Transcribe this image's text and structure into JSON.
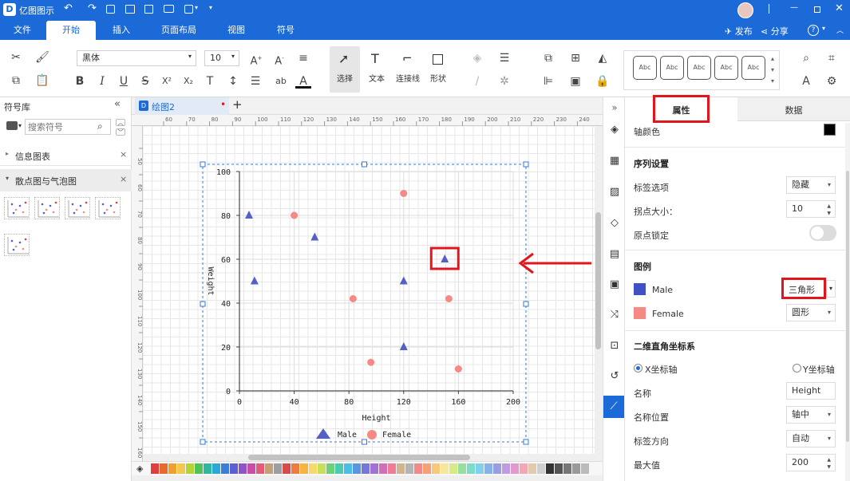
{
  "app": {
    "title": "亿图图示"
  },
  "menu": {
    "items": [
      "文件",
      "开始",
      "插入",
      "页面布局",
      "视图",
      "符号"
    ],
    "right": {
      "publish": "发布",
      "share": "分享",
      "help": "?"
    }
  },
  "ribbon": {
    "font_family": "黑体",
    "font_size": "10",
    "tools": {
      "select": "选择",
      "text": "文本",
      "connector": "连接线",
      "shape": "形状"
    },
    "style_box": "Abc"
  },
  "left_panel": {
    "title": "符号库",
    "search_placeholder": "搜索符号",
    "categories": [
      {
        "label": "信息图表",
        "expanded": false
      },
      {
        "label": "散点图与气泡图",
        "expanded": true
      }
    ]
  },
  "canvas": {
    "tab_label": "绘图2",
    "ruler_h": [
      "60",
      "70",
      "80",
      "90",
      "100",
      "110",
      "120",
      "130",
      "140",
      "150",
      "160",
      "170",
      "180",
      "190",
      "200",
      "210",
      "220",
      "230",
      "240"
    ],
    "ruler_v": [
      "50",
      "60",
      "70",
      "80",
      "90",
      "100",
      "110",
      "120",
      "130",
      "140",
      "150",
      "160"
    ]
  },
  "chart_data": {
    "type": "scatter",
    "xlabel": "Height",
    "ylabel": "Weight",
    "xlim": [
      0,
      200
    ],
    "ylim": [
      0,
      100
    ],
    "xticks": [
      "0",
      "40",
      "80",
      "120",
      "160",
      "200"
    ],
    "yticks": [
      "0",
      "20",
      "40",
      "60",
      "80",
      "100"
    ],
    "grid": true,
    "legend_position": "bottom",
    "series": [
      {
        "name": "Male",
        "marker": "triangle",
        "color": "#5560c4",
        "points": [
          [
            7,
            80
          ],
          [
            11,
            50
          ],
          [
            55,
            70
          ],
          [
            120,
            50
          ],
          [
            120,
            20
          ],
          [
            150,
            60
          ]
        ]
      },
      {
        "name": "Female",
        "marker": "circle",
        "color": "#f58a85",
        "points": [
          [
            40,
            80
          ],
          [
            83,
            42
          ],
          [
            96,
            13
          ],
          [
            120,
            90
          ],
          [
            153,
            42
          ],
          [
            160,
            10
          ]
        ]
      }
    ]
  },
  "right_panel": {
    "tabs": {
      "properties": "属性",
      "data": "数据"
    },
    "axis_color_label": "轴颜色",
    "series_settings": {
      "title": "序列设置",
      "label_option": "标签选项",
      "label_option_value": "隐藏",
      "point_size": "拐点大小：",
      "point_size_value": "10",
      "origin_lock": "原点锁定"
    },
    "legend": {
      "title": "图例",
      "items": [
        {
          "name": "Male",
          "color": "#3f51c4",
          "shape": "三角形"
        },
        {
          "name": "Female",
          "color": "#f58a85",
          "shape": "圆形"
        }
      ]
    },
    "axes": {
      "title": "二维直角坐标系",
      "x_axis": "X坐标轴",
      "y_axis": "Y坐标轴",
      "name_label": "名称",
      "name_value": "Height",
      "name_pos_label": "名称位置",
      "name_pos_value": "轴中",
      "label_dir_label": "标签方向",
      "label_dir_value": "自动",
      "max_label": "最大值",
      "max_value": "200"
    }
  },
  "colors": {
    "accent": "#1b6ad8",
    "highlight": "#e3151c"
  }
}
